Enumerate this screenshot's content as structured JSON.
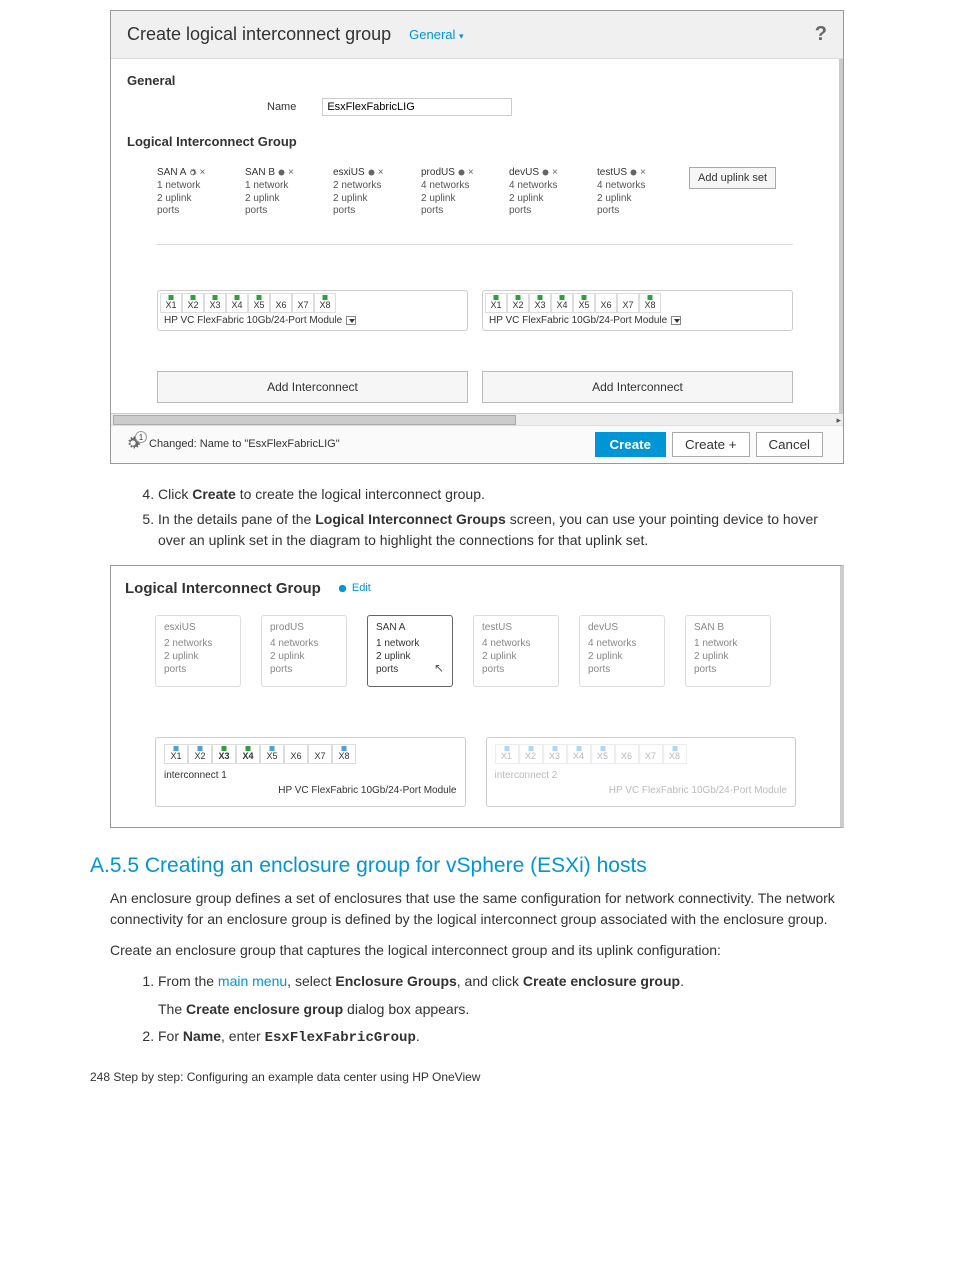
{
  "dialog": {
    "title": "Create logical interconnect group",
    "view_dropdown": "General",
    "help": "?",
    "sections": {
      "general_label": "General",
      "name_label": "Name",
      "name_value": "EsxFlexFabricLIG",
      "lig_label": "Logical Interconnect Group"
    },
    "uplink_sets": [
      {
        "name": "SAN A",
        "line1": "1 network",
        "line2": "2 uplink",
        "line3": "ports"
      },
      {
        "name": "SAN B",
        "line1": "1 network",
        "line2": "2 uplink",
        "line3": "ports"
      },
      {
        "name": "esxiUS",
        "line1": "2 networks",
        "line2": "2 uplink",
        "line3": "ports"
      },
      {
        "name": "prodUS",
        "line1": "4 networks",
        "line2": "2 uplink",
        "line3": "ports"
      },
      {
        "name": "devUS",
        "line1": "4 networks",
        "line2": "2 uplink",
        "line3": "ports"
      },
      {
        "name": "testUS",
        "line1": "4 networks",
        "line2": "2 uplink",
        "line3": "ports"
      }
    ],
    "add_uplink_set": "Add uplink set",
    "ports": [
      "X1",
      "X2",
      "X3",
      "X4",
      "X5",
      "X6",
      "X7",
      "X8"
    ],
    "module_name": "HP VC FlexFabric 10Gb/24-Port Module",
    "add_interconnect": "Add Interconnect",
    "changed_text": "Changed: Name to \"EsxFlexFabricLIG\"",
    "btn_create": "Create",
    "btn_create_plus": "Create +",
    "btn_cancel": "Cancel",
    "badge_count": "1"
  },
  "doc1": {
    "item4_pre": "Click ",
    "item4_bold": "Create",
    "item4_post": " to create the logical interconnect group.",
    "item5_pre": "In the details pane of the ",
    "item5_bold": "Logical Interconnect Groups",
    "item5_post": " screen, you can use your pointing device to hover over an uplink set in the diagram to highlight the connections for that uplink set."
  },
  "detail": {
    "title": "Logical Interconnect Group",
    "edit": "Edit",
    "cards": [
      {
        "name": "esxiUS",
        "l1": "2 networks",
        "l2": "2 uplink",
        "l3": "ports",
        "active": false
      },
      {
        "name": "prodUS",
        "l1": "4 networks",
        "l2": "2 uplink",
        "l3": "ports",
        "active": false
      },
      {
        "name": "SAN A",
        "l1": "1 network",
        "l2": "2 uplink",
        "l3": "ports",
        "active": true
      },
      {
        "name": "testUS",
        "l1": "4 networks",
        "l2": "2 uplink",
        "l3": "ports",
        "active": false
      },
      {
        "name": "devUS",
        "l1": "4 networks",
        "l2": "2 uplink",
        "l3": "ports",
        "active": false
      },
      {
        "name": "SAN B",
        "l1": "1 network",
        "l2": "2 uplink",
        "l3": "ports",
        "active": false
      }
    ],
    "ports": [
      "X1",
      "X2",
      "X3",
      "X4",
      "X5",
      "X6",
      "X7",
      "X8"
    ],
    "ic1_label": "interconnect 1",
    "ic2_label": "interconnect 2",
    "module": "HP VC FlexFabric 10Gb/24-Port Module"
  },
  "section": {
    "heading": "A.5.5 Creating an enclosure group for vSphere (ESXi) hosts",
    "p1": "An enclosure group defines a set of enclosures that use the same configuration for network connectivity. The network connectivity for an enclosure group is defined by the logical interconnect group associated with the enclosure group.",
    "p2": "Create an enclosure group that captures the logical interconnect group and its uplink configuration:",
    "li1_pre": "From the ",
    "li1_link": "main menu",
    "li1_mid": ", select ",
    "li1_b1": "Enclosure Groups",
    "li1_mid2": ", and click ",
    "li1_b2": "Create enclosure group",
    "li1_post": ".",
    "li1_line2_pre": "The ",
    "li1_line2_b": "Create enclosure group",
    "li1_line2_post": " dialog box appears.",
    "li2_pre": "For ",
    "li2_b": "Name",
    "li2_mid": ", enter ",
    "li2_code": "EsxFlexFabricGroup",
    "li2_post": "."
  },
  "page_footer": "248   Step by step: Configuring an example data center using HP OneView"
}
